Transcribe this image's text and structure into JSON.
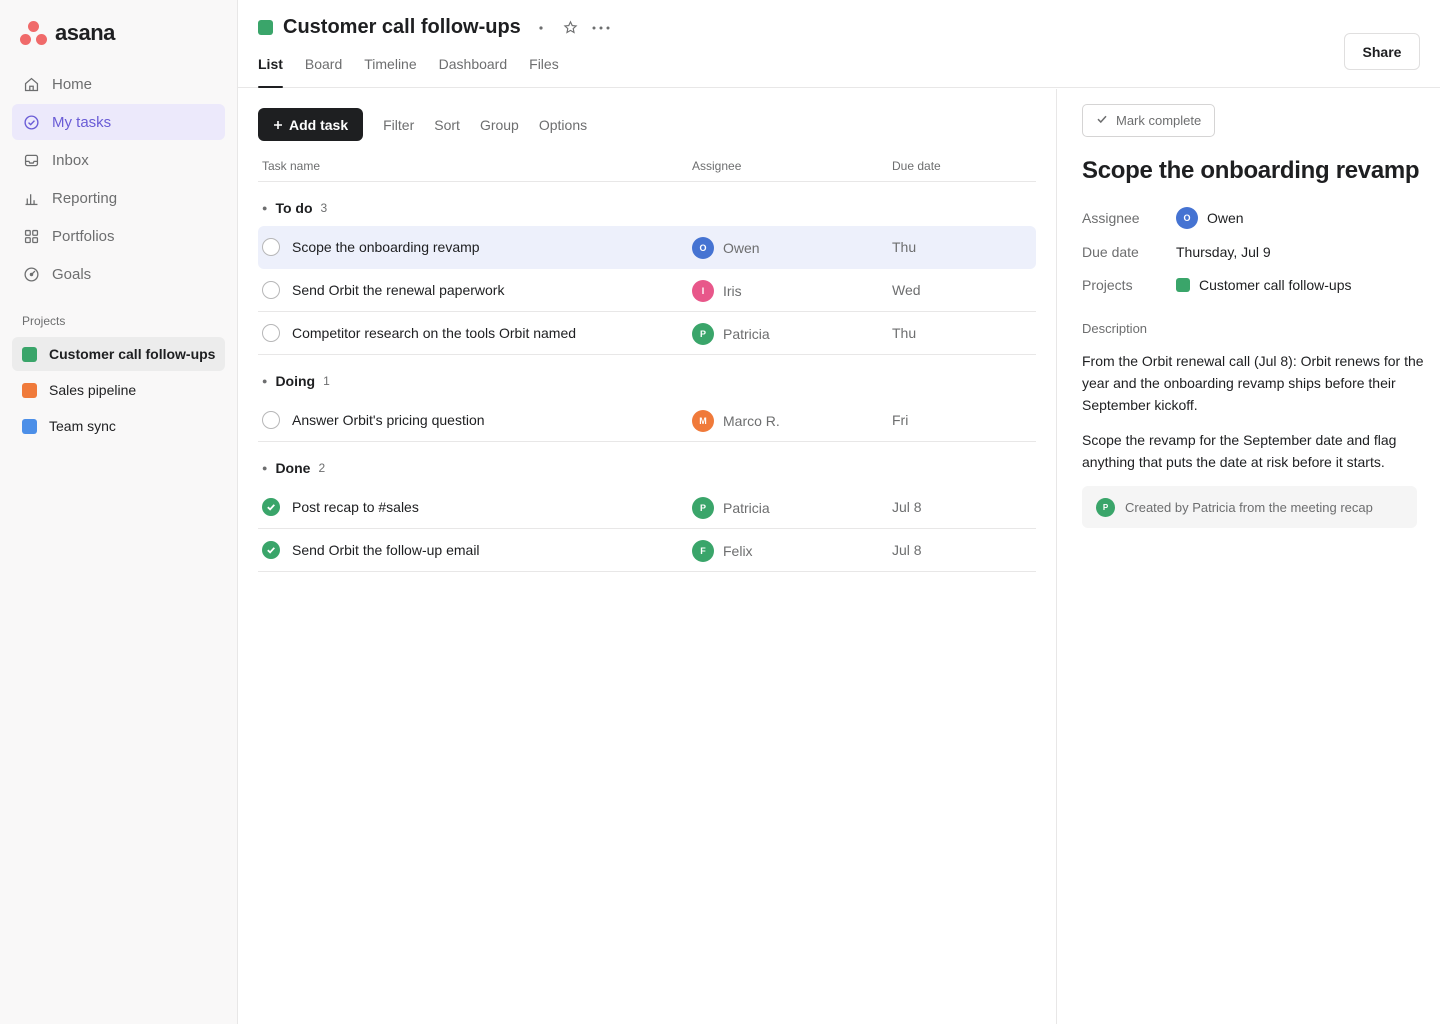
{
  "app": {
    "logo_text": "asana",
    "logo_colors": [
      "#f06a6a"
    ]
  },
  "sidebar": {
    "nav": [
      {
        "label": "Home",
        "icon": "home-icon"
      },
      {
        "label": "My tasks",
        "icon": "check-circle-icon",
        "active": true
      },
      {
        "label": "Inbox",
        "icon": "inbox-icon"
      },
      {
        "label": "Reporting",
        "icon": "bar-chart-icon"
      },
      {
        "label": "Portfolios",
        "icon": "grid-icon"
      },
      {
        "label": "Goals",
        "icon": "target-icon"
      }
    ],
    "projects_heading": "Projects",
    "projects": [
      {
        "label": "Customer call follow-ups",
        "color": "#3aa56a",
        "active": true
      },
      {
        "label": "Sales pipeline",
        "color": "#f07a3a"
      },
      {
        "label": "Team sync",
        "color": "#4c8fe8"
      }
    ]
  },
  "header": {
    "title": "Customer call follow-ups",
    "title_color": "#3aa56a",
    "tabs": [
      {
        "label": "List",
        "active": true
      },
      {
        "label": "Board"
      },
      {
        "label": "Timeline"
      },
      {
        "label": "Dashboard"
      },
      {
        "label": "Files"
      }
    ],
    "share_label": "Share"
  },
  "toolbar": {
    "add_task_label": "Add task",
    "tools": [
      "Filter",
      "Sort",
      "Group",
      "Options"
    ]
  },
  "columns": {
    "name": "Task name",
    "assignee": "Assignee",
    "due": "Due date"
  },
  "sections": [
    {
      "title": "To do",
      "count": "3",
      "tasks": [
        {
          "name": "Scope the onboarding revamp",
          "assignee": "Owen",
          "initial": "O",
          "avatar_color": "#4573d2",
          "due": "Thu",
          "done": false,
          "selected": true
        },
        {
          "name": "Send Orbit the renewal paperwork",
          "assignee": "Iris",
          "initial": "I",
          "avatar_color": "#e8578a",
          "due": "Wed",
          "done": false
        },
        {
          "name": "Competitor research on the tools Orbit named",
          "assignee": "Patricia",
          "initial": "P",
          "avatar_color": "#3aa56a",
          "due": "Thu",
          "done": false
        }
      ]
    },
    {
      "title": "Doing",
      "count": "1",
      "tasks": [
        {
          "name": "Answer Orbit's pricing question",
          "assignee": "Marco R.",
          "initial": "M",
          "avatar_color": "#f07a3a",
          "due": "Fri",
          "done": false
        }
      ]
    },
    {
      "title": "Done",
      "count": "2",
      "tasks": [
        {
          "name": "Post recap to #sales",
          "assignee": "Patricia",
          "initial": "P",
          "avatar_color": "#3aa56a",
          "due": "Jul 8",
          "done": true
        },
        {
          "name": "Send Orbit the follow-up email",
          "assignee": "Felix",
          "initial": "F",
          "avatar_color": "#3aa56a",
          "due": "Jul 8",
          "done": true
        }
      ]
    }
  ],
  "detail": {
    "mark_complete_label": "Mark complete",
    "title": "Scope the onboarding revamp",
    "assignee_label": "Assignee",
    "assignee": "Owen",
    "assignee_initial": "O",
    "assignee_color": "#4573d2",
    "due_label": "Due date",
    "due": "Thursday, Jul 9",
    "projects_label": "Projects",
    "project": "Customer call follow-ups",
    "project_color": "#3aa56a",
    "description_label": "Description",
    "description": [
      "From the Orbit renewal call (Jul 8): Orbit renews for the year and the onboarding revamp ships before their September kickoff.",
      "Scope the revamp for the September date and flag anything that puts the date at risk before it starts."
    ],
    "created_by": "Created by Patricia from the meeting recap",
    "created_initial": "P",
    "created_color": "#3aa56a"
  }
}
